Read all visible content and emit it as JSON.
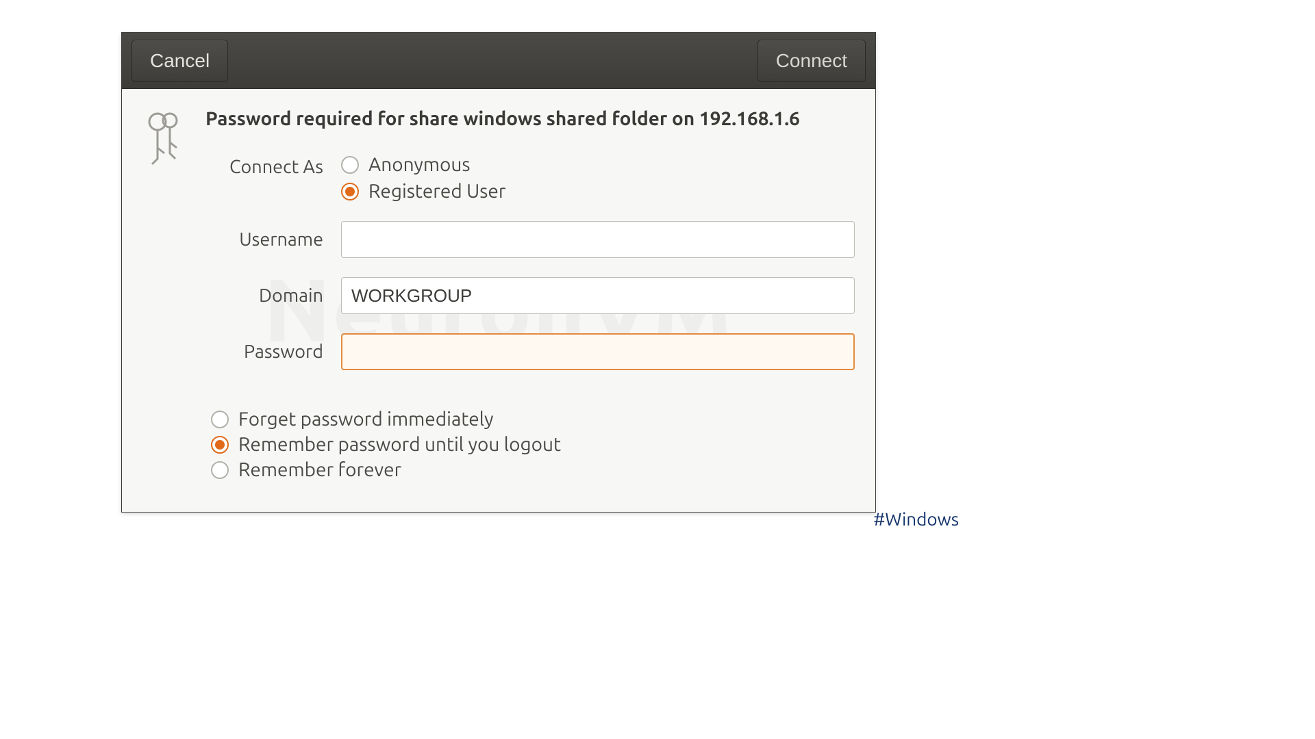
{
  "titlebar": {
    "cancel_label": "Cancel",
    "connect_label": "Connect"
  },
  "heading": "Password required for share windows shared folder on 192.168.1.6",
  "connect_as": {
    "label": "Connect As",
    "options": {
      "anonymous": "Anonymous",
      "registered": "Registered User"
    },
    "selected": "registered"
  },
  "fields": {
    "username": {
      "label": "Username",
      "value": ""
    },
    "domain": {
      "label": "Domain",
      "value": "WORKGROUP"
    },
    "password": {
      "label": "Password",
      "value": ""
    }
  },
  "remember": {
    "options": {
      "forget": "Forget password immediately",
      "session": "Remember password until you logout",
      "forever": "Remember forever"
    },
    "selected": "session"
  },
  "watermark": "NeuronVM",
  "hashtag": "#Windows"
}
